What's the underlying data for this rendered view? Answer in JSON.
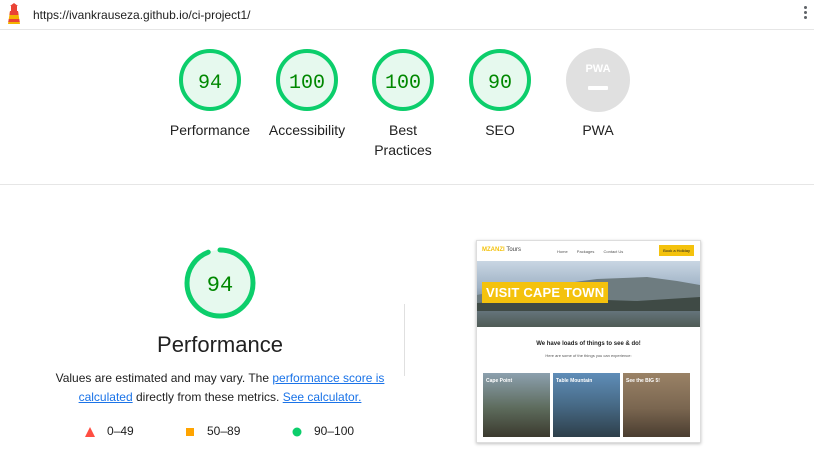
{
  "browser": {
    "url": "https://ivankrauseza.github.io/ci-project1/"
  },
  "colors": {
    "pass": "#0cce6b",
    "pass_bg": "#e6f9ee",
    "pass_text": "#008800",
    "average": "#ffa400",
    "fail": "#ff4e42",
    "na": "#e0e0e0",
    "link": "#1a73e8"
  },
  "summary": [
    {
      "label": "Performance",
      "score": "94"
    },
    {
      "label": "Accessibility",
      "score": "100"
    },
    {
      "label": "Best Practices",
      "score": "100"
    },
    {
      "label": "SEO",
      "score": "90"
    },
    {
      "label": "PWA",
      "score": "PWA"
    }
  ],
  "performance": {
    "score": "94",
    "title": "Performance",
    "desc_prefix": "Values are estimated and may vary. The ",
    "link1": "performance score is calculated",
    "desc_mid": " directly from these metrics. ",
    "link2": "See calculator."
  },
  "legend": [
    {
      "range": "0–49",
      "icon": "triangle-icon"
    },
    {
      "range": "50–89",
      "icon": "square-icon"
    },
    {
      "range": "90–100",
      "icon": "circle-icon"
    }
  ],
  "screenshot": {
    "brand": "MZANZI",
    "brand_suffix": "Tours",
    "nav": [
      "Home",
      "Packages",
      "Contact Us"
    ],
    "button": "Book a Holiday",
    "banner": "VISIT CAPE TOWN",
    "heading": "We have loads of things to see & do!",
    "subheading": "Here are some of the things you can experience:",
    "cards": [
      "Cape Point",
      "Table Mountain",
      "See the BIG 5!"
    ]
  }
}
